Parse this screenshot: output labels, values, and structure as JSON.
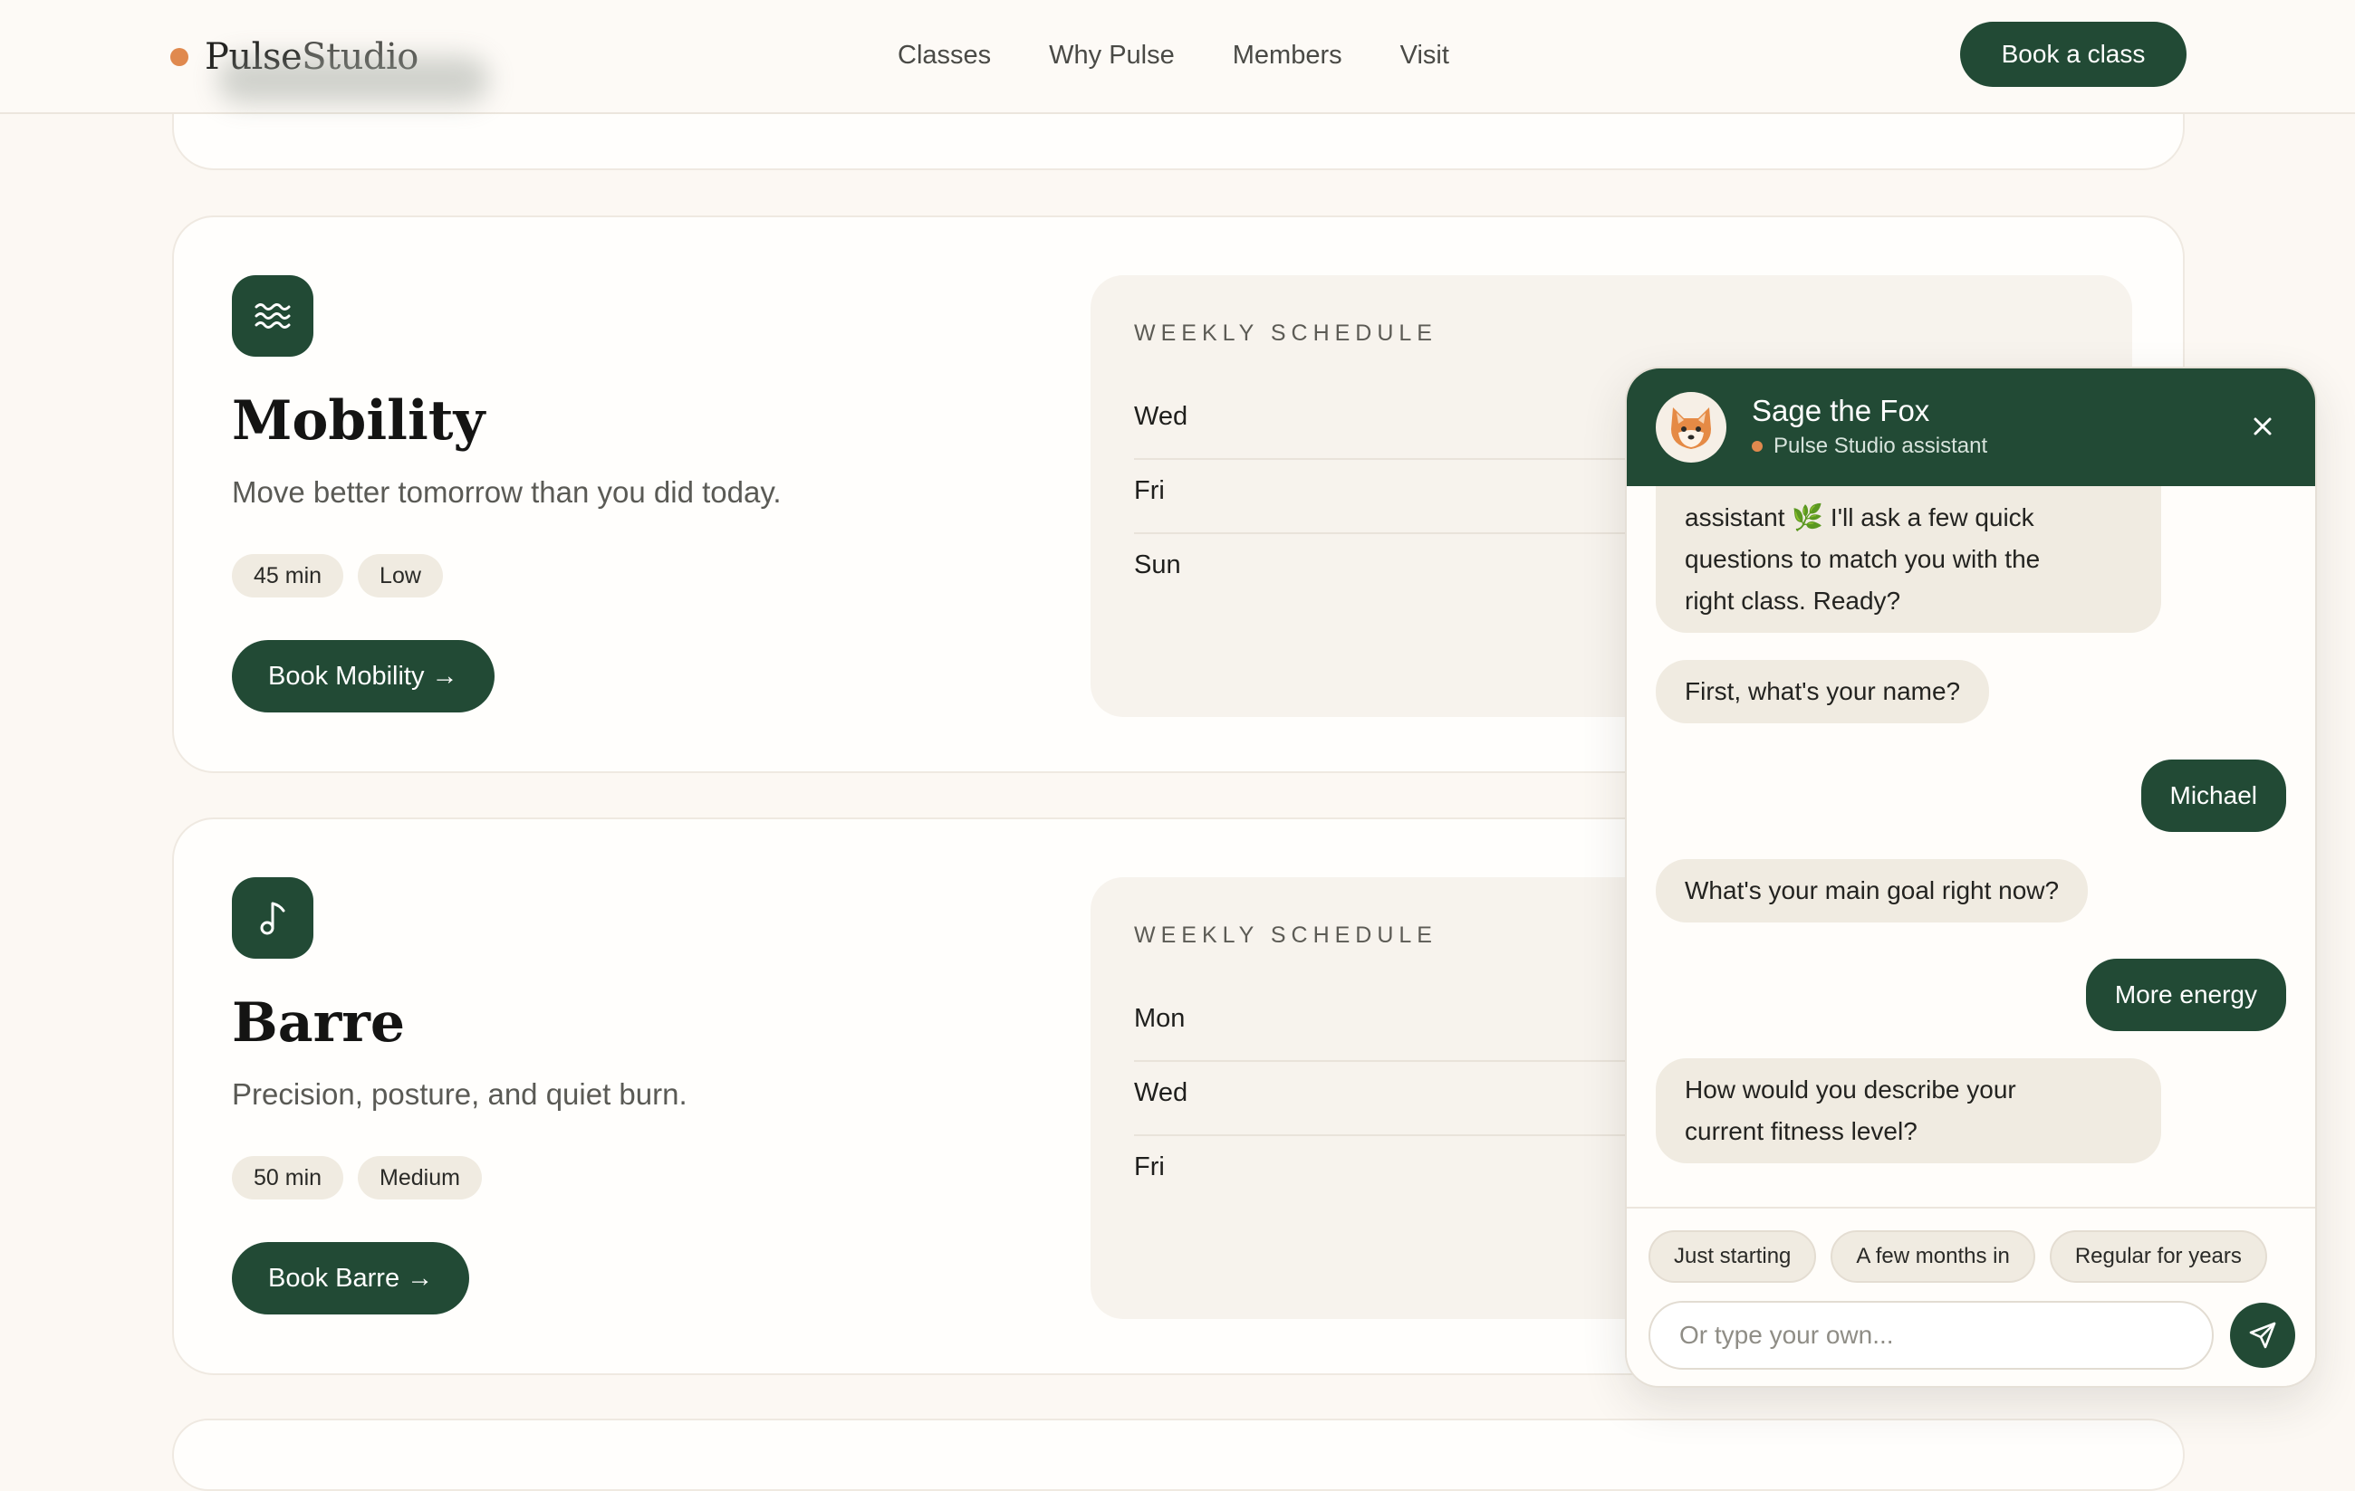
{
  "header": {
    "logo_bold": "Pulse",
    "logo_light": "Studio",
    "nav": [
      "Classes",
      "Why Pulse",
      "Members",
      "Visit"
    ],
    "cta": "Book a class"
  },
  "classes": [
    {
      "icon": "waves-icon",
      "title": "Mobility",
      "description": "Move better tomorrow than you did today.",
      "duration": "45 min",
      "intensity": "Low",
      "book_label": "Book Mobility →",
      "schedule_label": "WEEKLY SCHEDULE",
      "days": [
        "Wed",
        "Fri",
        "Sun"
      ]
    },
    {
      "icon": "music-note-icon",
      "title": "Barre",
      "description": "Precision, posture, and quiet burn.",
      "duration": "50 min",
      "intensity": "Medium",
      "book_label": "Book Barre →",
      "schedule_label": "WEEKLY SCHEDULE",
      "days": [
        "Mon",
        "Wed",
        "Fri"
      ]
    }
  ],
  "chat": {
    "name": "Sage the Fox",
    "subtitle": "Pulse Studio assistant",
    "avatar_icon": "fox-icon",
    "messages": [
      {
        "from": "bot",
        "lines": [
          "assistant 🌿 I'll ask a few quick",
          "questions to match you with the",
          "right class. Ready?"
        ]
      },
      {
        "from": "bot",
        "lines": [
          "First, what's your name?"
        ]
      },
      {
        "from": "user",
        "lines": [
          "Michael"
        ]
      },
      {
        "from": "bot",
        "lines": [
          "What's your main goal right now?"
        ]
      },
      {
        "from": "user",
        "lines": [
          "More energy"
        ]
      },
      {
        "from": "bot",
        "lines": [
          "How would you describe your",
          "current fitness level?"
        ]
      }
    ],
    "quick_replies": [
      "Just starting",
      "A few months in",
      "Regular for years"
    ],
    "input_placeholder": "Or type your own...",
    "input_value": ""
  },
  "colors": {
    "primary": "#224a35",
    "accent": "#e0894e",
    "background": "#fcf8f3",
    "pill": "#f0ebe1"
  }
}
